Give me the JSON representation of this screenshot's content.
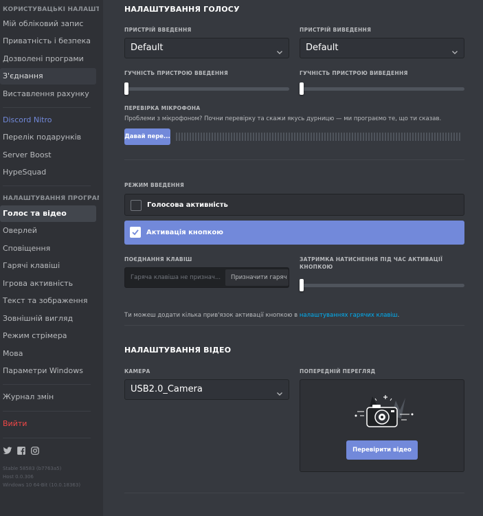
{
  "sidebar": {
    "user_settings_header": "КОРИСТУВАЦЬКІ НАЛАШТУВАННЯ",
    "user_items": [
      "Мій обліковий запис",
      "Приватність і безпека",
      "Дозволені програми",
      "З'єднання",
      "Виставлення рахунку"
    ],
    "billing_items": [
      "Discord Nitro",
      "Перелік подарунків",
      "Server Boost",
      "HypeSquad"
    ],
    "app_settings_header": "НАЛАШТУВАННЯ ПРОГРАМИ",
    "app_items": [
      "Голос та відео",
      "Оверлей",
      "Сповіщення",
      "Гарячі клавіші",
      "Ігрова активність",
      "Текст та зображення",
      "Зовнішній вигляд",
      "Режим стрімера",
      "Мова",
      "Параметри Windows"
    ],
    "changelog": "Журнал змін",
    "logout": "Вийти",
    "social_icons": [
      "twitter-icon",
      "facebook-icon",
      "instagram-icon"
    ],
    "version_lines": [
      "Stable 58583 (b7763a5)",
      "Host 0.0.306",
      "Windows 10 64-Bit (10.0.18363)"
    ]
  },
  "voice": {
    "title": "НАЛАШТУВАННЯ ГОЛОСУ",
    "input_device_label": "ПРИСТРІЙ ВВЕДЕННЯ",
    "input_device_value": "Default",
    "output_device_label": "ПРИСТРІЙ ВИВЕДЕННЯ",
    "output_device_value": "Default",
    "input_volume_label": "ГУЧНІСТЬ ПРИСТРОЮ ВВЕДЕННЯ",
    "input_volume": 0,
    "output_volume_label": "ГУЧНІСТЬ ПРИСТРОЮ ВИВЕДЕННЯ",
    "output_volume": 0,
    "mic_test_label": "ПЕРЕВІРКА МІКРОФОНА",
    "mic_test_desc": "Проблеми з мікрофоном? Почни перевірку та скажи якусь дурницю — ми програємо те, що ти сказав.",
    "mic_test_button": "Давай пере...",
    "input_mode_label": "РЕЖИМ ВВЕДЕННЯ",
    "mode_voice_activity": "Голосова активність",
    "mode_push_to_talk": "Активація кнопкою",
    "selected_mode": "push_to_talk",
    "shortcut_label": "ПОЄДНАННЯ КЛАВІШ",
    "shortcut_placeholder": "Гаряча клавіша не признач...",
    "shortcut_button": "Призначити гаряч",
    "release_delay_label_line1": "ЗАТРИМКА НАТИСНЕННЯ ПІД ЧАС АКТИВАЦІЇ",
    "release_delay_label_line2": "КНОПКОЮ",
    "release_delay": 0,
    "keybinds_hint_prefix": "Ти можеш додати кілька прив'язок активації кнопкою в ",
    "keybinds_hint_link": "налаштуваннях гарячих клавіш",
    "keybinds_hint_suffix": "."
  },
  "video": {
    "title": "НАЛАШТУВАННЯ ВІДЕО",
    "camera_label": "КАМЕРА",
    "camera_value": "USB2.0_Camera",
    "preview_label": "ПОПЕРЕДНІЙ ПЕРЕГЛЯД",
    "test_video_button": "Перевірити відео"
  },
  "colors": {
    "accent": "#7289da",
    "background": "#36393f",
    "sidebar": "#2f3136",
    "danger": "#f04747",
    "link": "#00b0f4"
  }
}
